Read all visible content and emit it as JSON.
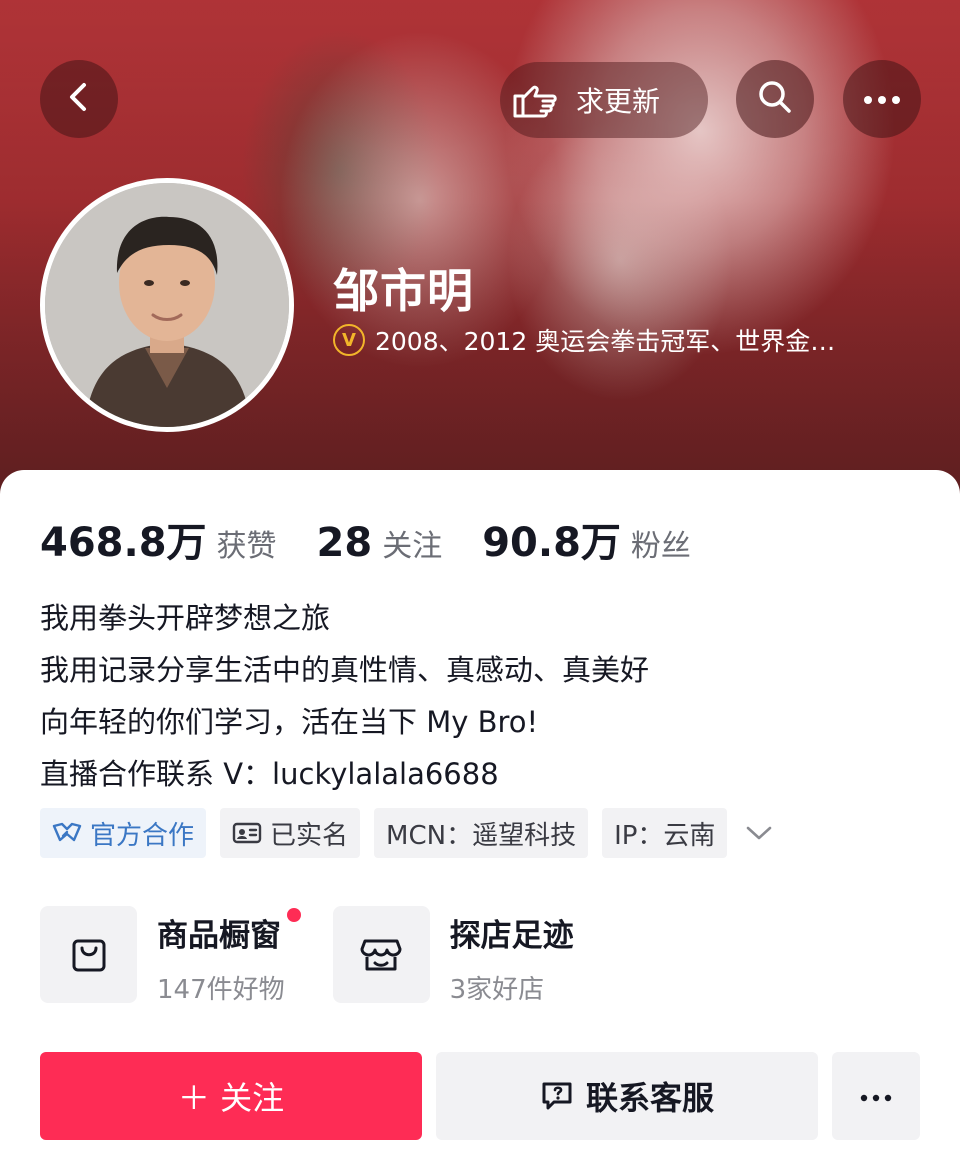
{
  "header": {
    "ask_update_label": "求更新",
    "name": "邹市明",
    "verify_text": "2008、2012 奥运会拳击冠军、世界金…",
    "verify_badge": "V"
  },
  "stats": [
    {
      "value": "468.8万",
      "label": "获赞"
    },
    {
      "value": "28",
      "label": "关注"
    },
    {
      "value": "90.8万",
      "label": "粉丝"
    }
  ],
  "bio": [
    "我用拳头开辟梦想之旅",
    "我用记录分享生活中的真性情、真感动、真美好",
    "向年轻的你们学习，活在当下 My Bro!",
    "直播合作联系 V：luckylalala6688"
  ],
  "tags": {
    "official": "官方合作",
    "realname": "已实名",
    "mcn": "MCN：遥望科技",
    "ip": "IP：云南"
  },
  "shops": [
    {
      "title": "商品橱窗",
      "sub": "147件好物"
    },
    {
      "title": "探店足迹",
      "sub": "3家好店"
    }
  ],
  "actions": {
    "follow": "＋ 关注",
    "contact": "联系客服"
  },
  "colors": {
    "accent": "#fe2c55",
    "verify_gold": "#f2b52a",
    "official_blue": "#3b77c4"
  }
}
